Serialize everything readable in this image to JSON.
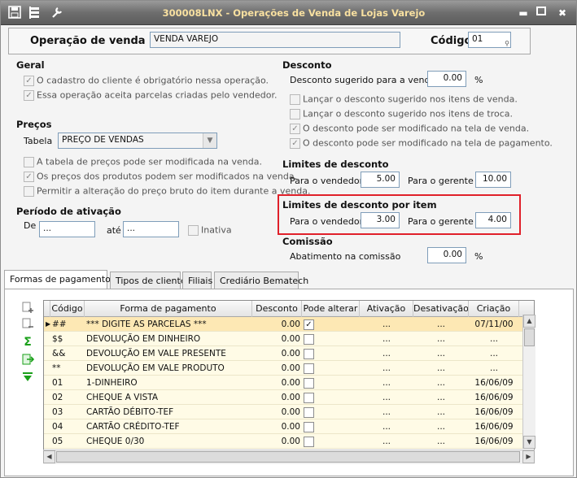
{
  "window": {
    "title": "300008LNX - Operações de Venda de Lojas Varejo"
  },
  "header": {
    "operacao_label": "Operação de venda",
    "operacao_value": "VENDA VAREJO",
    "codigo_label": "Código",
    "codigo_value": "01"
  },
  "geral": {
    "title": "Geral",
    "opt1": "O cadastro do cliente é obrigatório nessa operação.",
    "opt2": "Essa operação aceita parcelas criadas pelo vendedor."
  },
  "precos": {
    "title": "Preços",
    "tabela_label": "Tabela",
    "tabela_value": "PREÇO DE VENDAS",
    "opt1": "A tabela de preços pode ser modificada na venda.",
    "opt2": "Os preços dos produtos podem ser modificados na venda.",
    "opt3": "Permitir a alteração do preço bruto do item durante a venda."
  },
  "periodo": {
    "title": "Período de ativação",
    "de_label": "De",
    "de_value": "...",
    "ate_label": "até",
    "ate_value": "...",
    "inativa_label": "Inativa"
  },
  "desconto": {
    "title": "Desconto",
    "sugerido_label": "Desconto sugerido para a venda",
    "sugerido_value": "0.00",
    "pct": "%",
    "opt1": "Lançar o desconto sugerido nos itens de venda.",
    "opt2": "Lançar o desconto sugerido nos itens de troca.",
    "opt3": "O desconto pode ser modificado na tela de venda.",
    "opt4": "O desconto pode ser modificado na tela de pagamento."
  },
  "limites": {
    "title": "Limites de desconto",
    "vendedor_label": "Para o vendedor",
    "vendedor_value": "5.00",
    "gerente_label": "Para o gerente",
    "gerente_value": "10.00"
  },
  "limites_item": {
    "title": "Limites de desconto por item",
    "vendedor_label": "Para o vendedor",
    "vendedor_value": "3.00",
    "gerente_label": "Para o gerente",
    "gerente_value": "4.00"
  },
  "comissao": {
    "title": "Comissão",
    "abatimento_label": "Abatimento na comissão",
    "abatimento_value": "0.00",
    "pct": "%"
  },
  "tabs": [
    "Formas de pagamentos",
    "Tipos de cliente",
    "Filiais",
    "Crediário Bematech"
  ],
  "grid": {
    "columns": [
      "Código",
      "Forma de pagamento",
      "Desconto",
      "Pode alterar",
      "Ativação",
      "Desativação",
      "Criação"
    ],
    "rows": [
      {
        "codigo": "##",
        "forma": "*** DIGITE AS PARCELAS ***",
        "desconto": "0.00",
        "pode_alterar": true,
        "ativacao": "...",
        "desativacao": "...",
        "criacao": "07/11/00"
      },
      {
        "codigo": "$$",
        "forma": "DEVOLUÇÃO EM DINHEIRO",
        "desconto": "0.00",
        "pode_alterar": false,
        "ativacao": "...",
        "desativacao": "...",
        "criacao": "..."
      },
      {
        "codigo": "&&",
        "forma": "DEVOLUÇÃO EM VALE PRESENTE",
        "desconto": "0.00",
        "pode_alterar": false,
        "ativacao": "...",
        "desativacao": "...",
        "criacao": "..."
      },
      {
        "codigo": "**",
        "forma": "DEVOLUÇÃO EM VALE PRODUTO",
        "desconto": "0.00",
        "pode_alterar": false,
        "ativacao": "...",
        "desativacao": "...",
        "criacao": "..."
      },
      {
        "codigo": "01",
        "forma": "1-DINHEIRO",
        "desconto": "0.00",
        "pode_alterar": false,
        "ativacao": "...",
        "desativacao": "...",
        "criacao": "16/06/09"
      },
      {
        "codigo": "02",
        "forma": "CHEQUE A VISTA",
        "desconto": "0.00",
        "pode_alterar": false,
        "ativacao": "...",
        "desativacao": "...",
        "criacao": "16/06/09"
      },
      {
        "codigo": "03",
        "forma": "CARTÃO DÉBITO-TEF",
        "desconto": "0.00",
        "pode_alterar": false,
        "ativacao": "...",
        "desativacao": "...",
        "criacao": "16/06/09"
      },
      {
        "codigo": "04",
        "forma": "CARTÃO CRÉDITO-TEF",
        "desconto": "0.00",
        "pode_alterar": false,
        "ativacao": "...",
        "desativacao": "...",
        "criacao": "16/06/09"
      },
      {
        "codigo": "05",
        "forma": "CHEQUE 0/30",
        "desconto": "0.00",
        "pode_alterar": false,
        "ativacao": "...",
        "desativacao": "...",
        "criacao": "16/06/09"
      }
    ]
  },
  "icons": {
    "toolbar": [
      "save-icon",
      "filter-icon",
      "wrench-icon"
    ],
    "side": [
      "add-row-icon",
      "remove-row-icon",
      "sum-icon",
      "export-icon",
      "collapse-icon"
    ]
  },
  "colors": {
    "highlight": "#e0202a",
    "title_text": "#f8e0a0",
    "selected_row": "#fde8b4",
    "grid_row": "#fffbe6"
  }
}
